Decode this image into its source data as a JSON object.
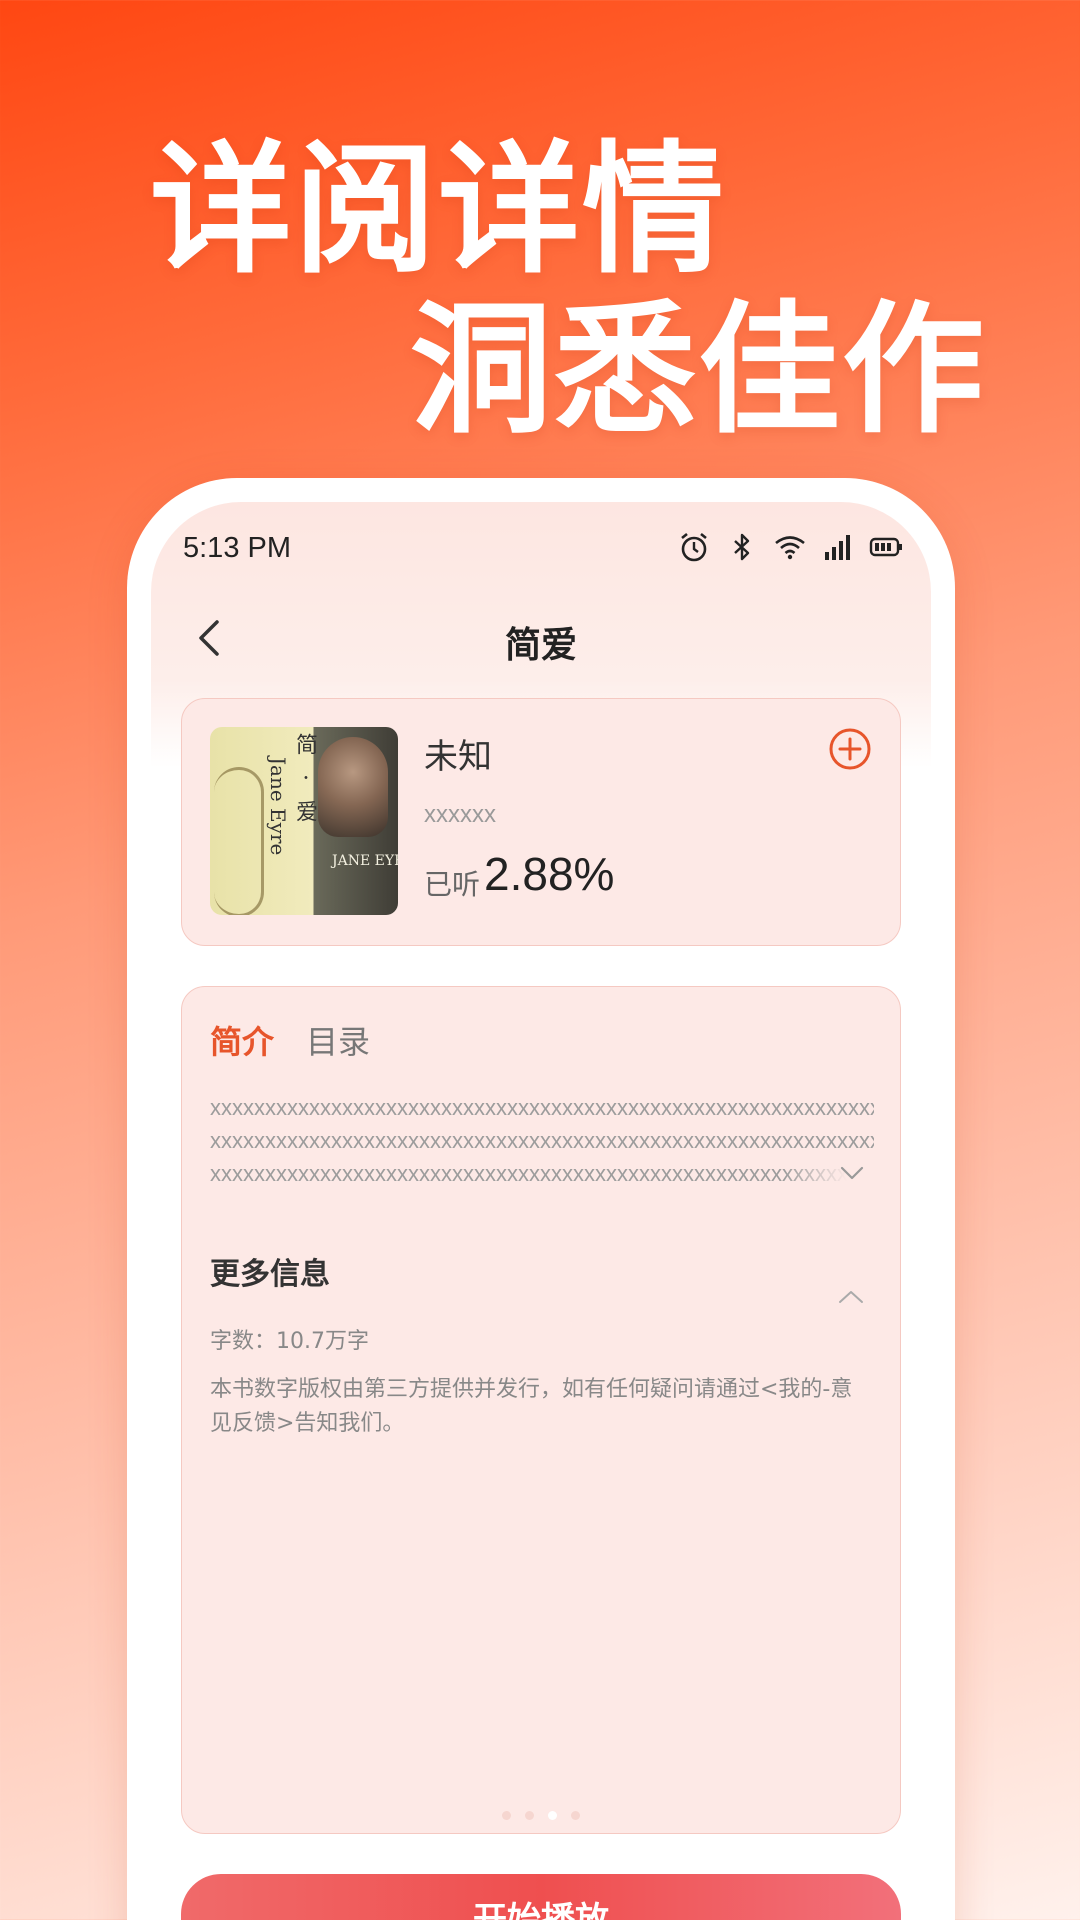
{
  "promo": {
    "headline_line1": "详阅详情",
    "headline_line2": "洞悉佳作"
  },
  "status_bar": {
    "time": "5:13 PM",
    "icons": [
      "alarm-icon",
      "bluetooth-icon",
      "wifi-icon",
      "signal-icon",
      "battery-icon"
    ]
  },
  "nav": {
    "title": "简爱"
  },
  "book": {
    "cover_title_cn": "简 · 爱",
    "cover_title_en": "Jane Eyre",
    "cover_logo": "JANE EYRE",
    "author": "未知",
    "subtitle": "xxxxxx",
    "progress_label": "已听",
    "progress_value": "2.88%"
  },
  "tabs": [
    {
      "label": "简介",
      "active": true
    },
    {
      "label": "目录",
      "active": false
    }
  ],
  "description": {
    "line1": "xxxxxxxxxxxxxxxxxxxxxxxxxxxxxxxxxxxxxxxxxxxxxxxxxxxxxxxxxxxxxx",
    "line2": "xxxxxxxxxxxxxxxxxxxxxxxxxxxxxxxxxxxxxxxxxxxxxxxxxxxxxxxxxxxxxx",
    "line3": "xxxxxxxxxxxxxxxxxxxxxxxxxxxxxxxxxxxxxxxxxxxxxxxxxxxxxxxxxxxxxx"
  },
  "more_info": {
    "title": "更多信息",
    "word_count": "字数：10.7万字",
    "copyright": "本书数字版权由第三方提供并发行，如有任何疑问请通过<我的-意见反馈>告知我们。"
  },
  "pager": {
    "count": 4,
    "active_index": 2
  },
  "play_button": {
    "label": "开始播放"
  },
  "colors": {
    "accent": "#e7552b",
    "card_bg": "#fde9e6",
    "play_button": "#ef4f4f"
  }
}
